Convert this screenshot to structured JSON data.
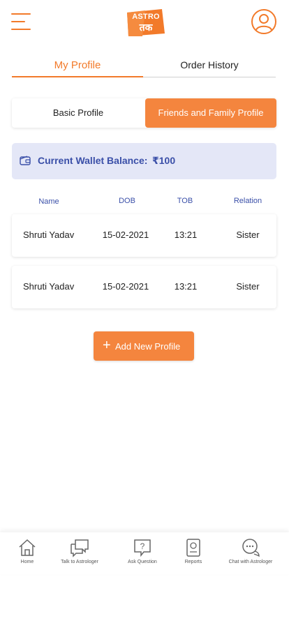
{
  "header": {
    "logo_text_top": "ASTRO",
    "logo_text_bottom": "तक",
    "menu_icon": "hamburger-icon",
    "profile_icon": "user-circle-icon"
  },
  "tabs": [
    {
      "label": "My Profile",
      "active": true
    },
    {
      "label": "Order History",
      "active": false
    }
  ],
  "segments": [
    {
      "label": "Basic Profile",
      "active": false
    },
    {
      "label": "Friends and Family Profile",
      "active": true
    }
  ],
  "wallet": {
    "icon": "wallet-icon",
    "label": "Current Wallet Balance:",
    "amount": "₹100"
  },
  "table": {
    "columns": [
      "Name",
      "DOB",
      "TOB",
      "Relation"
    ],
    "rows": [
      {
        "name": "Shruti Yadav",
        "dob": "15-02-2021",
        "tob": "13:21",
        "relation": "Sister"
      },
      {
        "name": "Shruti Yadav",
        "dob": "15-02-2021",
        "tob": "13:21",
        "relation": "Sister"
      }
    ]
  },
  "add_button": {
    "icon": "plus-icon",
    "label": "Add New Profile"
  },
  "bottom_nav": [
    {
      "label": "Home",
      "icon": "home-icon"
    },
    {
      "label": "Talk to Astrologer",
      "icon": "chat-bubbles-icon"
    },
    {
      "label": "Ask Question",
      "icon": "question-icon"
    },
    {
      "label": "Reports",
      "icon": "report-icon"
    },
    {
      "label": "Chat with Astrologer",
      "icon": "chat-dots-icon"
    }
  ],
  "colors": {
    "accent": "#f4853e",
    "wallet_bg": "#e4e7f7",
    "wallet_text": "#3a4fa8"
  }
}
